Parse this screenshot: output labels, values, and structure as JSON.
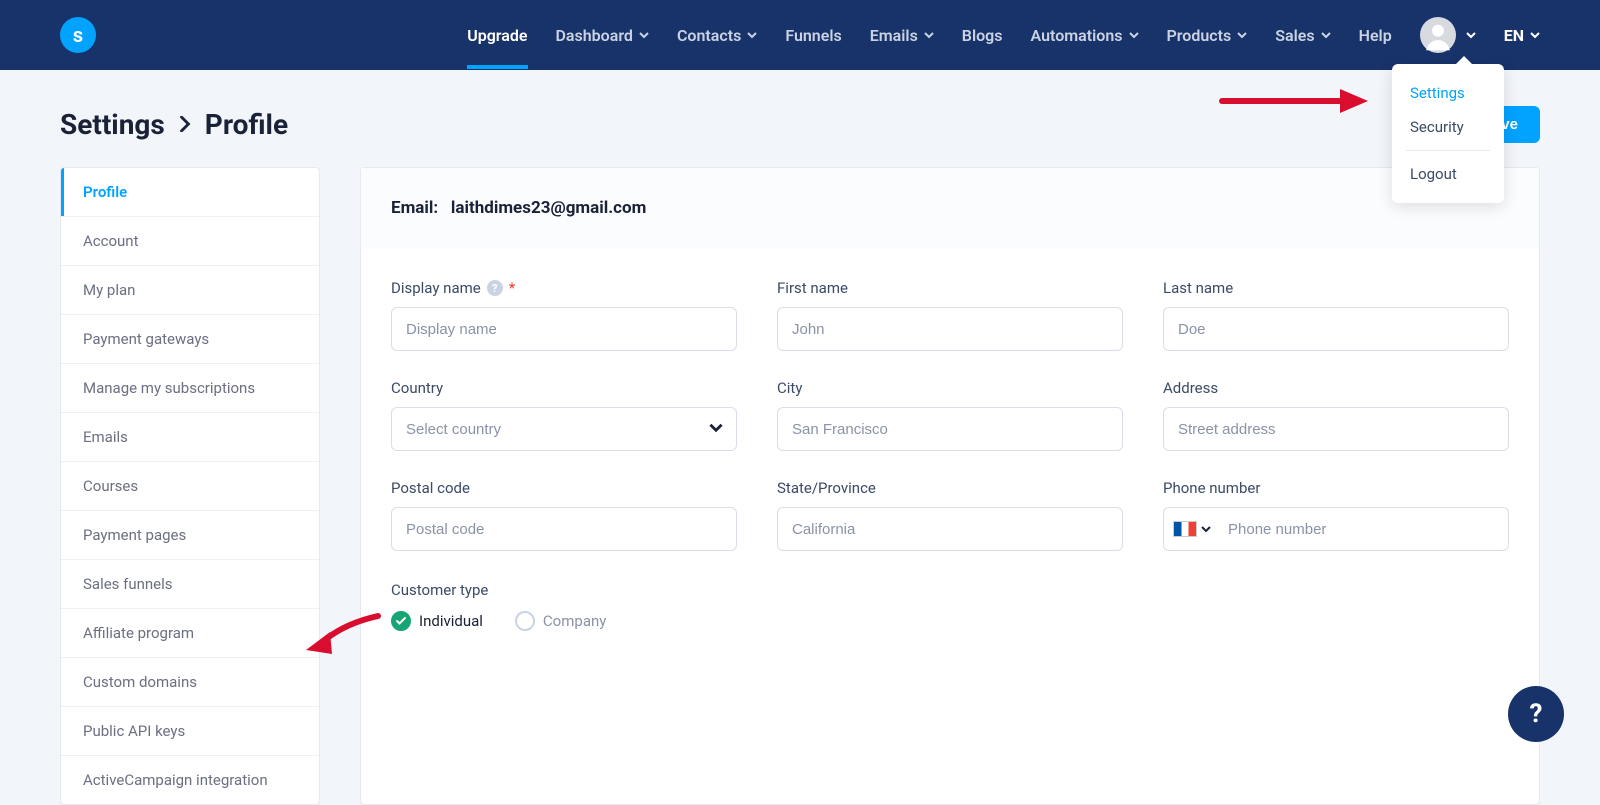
{
  "logo_letter": "s",
  "nav": {
    "upgrade": "Upgrade",
    "dashboard": "Dashboard",
    "contacts": "Contacts",
    "funnels": "Funnels",
    "emails": "Emails",
    "blogs": "Blogs",
    "automations": "Automations",
    "products": "Products",
    "sales": "Sales",
    "help": "Help",
    "lang": "EN"
  },
  "avatar_menu": {
    "settings": "Settings",
    "security": "Security",
    "logout": "Logout"
  },
  "breadcrumb": {
    "root": "Settings",
    "page": "Profile"
  },
  "save_label": "Save",
  "sidebar": [
    "Profile",
    "Account",
    "My plan",
    "Payment gateways",
    "Manage my subscriptions",
    "Emails",
    "Courses",
    "Payment pages",
    "Sales funnels",
    "Affiliate program",
    "Custom domains",
    "Public API keys",
    "ActiveCampaign integration"
  ],
  "profile": {
    "email_label": "Email:",
    "email_value": "laithdimes23@gmail.com",
    "display_name_label": "Display name",
    "display_name_placeholder": "Display name",
    "first_name_label": "First name",
    "first_name_placeholder": "John",
    "last_name_label": "Last name",
    "last_name_placeholder": "Doe",
    "country_label": "Country",
    "country_placeholder": "Select country",
    "city_label": "City",
    "city_placeholder": "San Francisco",
    "address_label": "Address",
    "address_placeholder": "Street address",
    "postal_label": "Postal code",
    "postal_placeholder": "Postal code",
    "state_label": "State/Province",
    "state_placeholder": "California",
    "phone_label": "Phone number",
    "phone_placeholder": "Phone number",
    "customer_type_label": "Customer type",
    "individual": "Individual",
    "company": "Company"
  },
  "help_icon_text": "?",
  "fab_text": "?"
}
